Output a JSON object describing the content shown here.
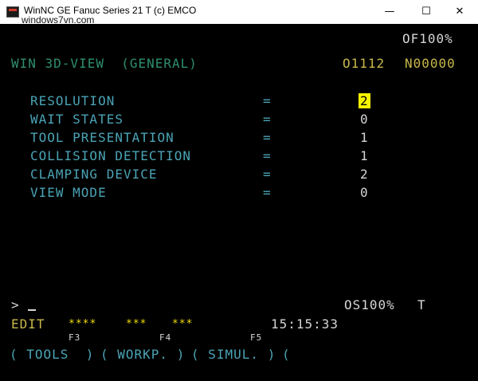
{
  "window": {
    "title": "WinNC GE Fanuc Series 21 T (c) EMCO",
    "watermark": "windows7vn.com",
    "min_icon": "—",
    "max_icon": "☐",
    "close_icon": "✕"
  },
  "header": {
    "of_value": "OF100%",
    "screen_title": "WIN 3D-VIEW  (GENERAL)",
    "program": "O1112",
    "sequence": "N00000"
  },
  "settings": [
    {
      "label": "RESOLUTION",
      "eq": "=",
      "value": "2"
    },
    {
      "label": "WAIT STATES",
      "eq": "=",
      "value": "0"
    },
    {
      "label": "TOOL PRESENTATION",
      "eq": "=",
      "value": "1"
    },
    {
      "label": "COLLISION DETECTION",
      "eq": "=",
      "value": "1"
    },
    {
      "label": "CLAMPING DEVICE",
      "eq": "=",
      "value": "2"
    },
    {
      "label": "VIEW MODE",
      "eq": "=",
      "value": "0"
    }
  ],
  "status": {
    "prompt": ">",
    "os_value": "OS100%",
    "mode_letter": "T",
    "mode": "EDIT",
    "stars_1": "****",
    "stars_2": "***",
    "stars_3": "***",
    "time": "15:15:33"
  },
  "softkeys": {
    "f3_label": "F3",
    "f4_label": "F4",
    "f5_label": "F5",
    "tools": "( TOOLS  )",
    "workp": "( WORKP. )",
    "simul": "( SIMUL. )",
    "extra": "("
  },
  "colors": {
    "background": "#000000",
    "highlight": "#f4f400"
  }
}
